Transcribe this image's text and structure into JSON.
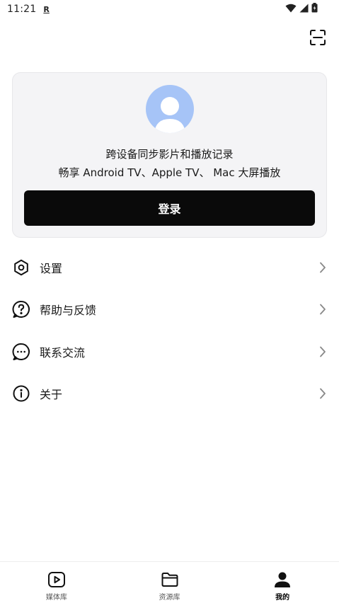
{
  "status_bar": {
    "time": "11:21",
    "carrier_badge": "R"
  },
  "header": {
    "scan_icon": "scan-frame-icon"
  },
  "login_card": {
    "line1": "跨设备同步影片和播放记录",
    "line2": "畅享 Android TV、Apple TV、 Mac 大屏播放",
    "login_label": "登录",
    "avatar_color": "#a6c4f7"
  },
  "menu": {
    "items": [
      {
        "label": "设置",
        "icon": "settings-hexagon-icon"
      },
      {
        "label": "帮助与反馈",
        "icon": "help-question-icon"
      },
      {
        "label": "联系交流",
        "icon": "chat-bubble-icon"
      },
      {
        "label": "关于",
        "icon": "info-icon"
      }
    ]
  },
  "bottom_nav": {
    "tabs": [
      {
        "label": "媒体库",
        "icon": "play-square-icon",
        "active": false
      },
      {
        "label": "资源库",
        "icon": "folder-icon",
        "active": false
      },
      {
        "label": "我的",
        "icon": "person-icon",
        "active": true
      }
    ]
  },
  "colors": {
    "accent": "#0a0a0a",
    "card_background": "#f4f4f6"
  }
}
